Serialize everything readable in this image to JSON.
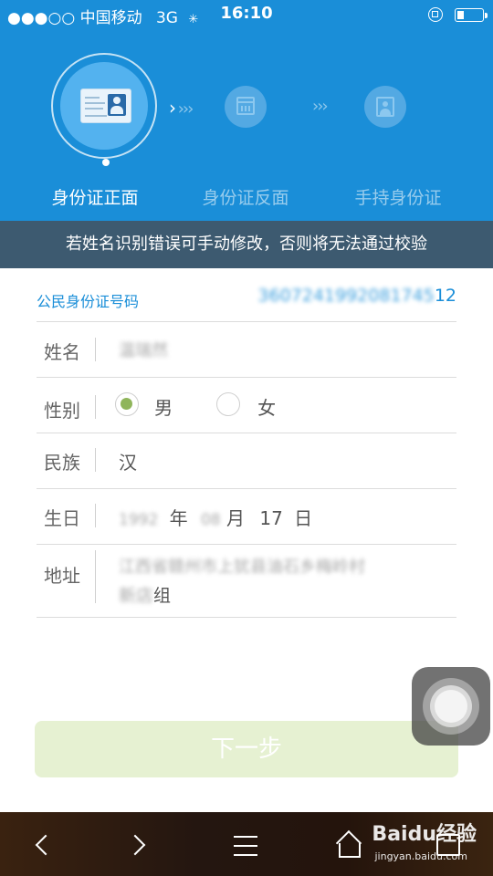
{
  "status_bar": {
    "signal_dots": "●●●○○",
    "carrier": "中国移动",
    "network": "3G",
    "time": "16:10"
  },
  "steps": [
    {
      "label": "身份证正面",
      "state": "active",
      "icon": "id-card-icon"
    },
    {
      "label": "身份证反面",
      "state": "inactive",
      "icon": "calendar-icon"
    },
    {
      "label": "手持身份证",
      "state": "inactive",
      "icon": "person-photo-icon"
    }
  ],
  "notice": "若姓名识别错误可手动修改，否则将无法通过校验",
  "form": {
    "id_number_label": "公民身份证号码",
    "id_number_value": "360724199208174512",
    "name_label": "姓名",
    "name_value": "温瑞然",
    "gender_label": "性别",
    "gender_options": [
      "男",
      "女"
    ],
    "gender_selected": "男",
    "ethnicity_label": "民族",
    "ethnicity_value": "汉",
    "birthday_label": "生日",
    "birth_year": "1992",
    "year_unit": "年",
    "birth_month": "08",
    "month_unit": "月",
    "birth_day": "17",
    "day_unit": "日",
    "address_label": "地址",
    "address_line1": "江西省赣州市上犹县油石乡梅岭村",
    "address_line2": "新店组"
  },
  "next_button": "下一步",
  "watermark": {
    "brand": "Baidu经验",
    "url": "jingyan.baidu.com"
  },
  "colors": {
    "accent": "#1a8ed8",
    "notice_bg": "#3d5a70",
    "radio_on": "#8fb55b",
    "button_bg": "#e6f1d2"
  }
}
